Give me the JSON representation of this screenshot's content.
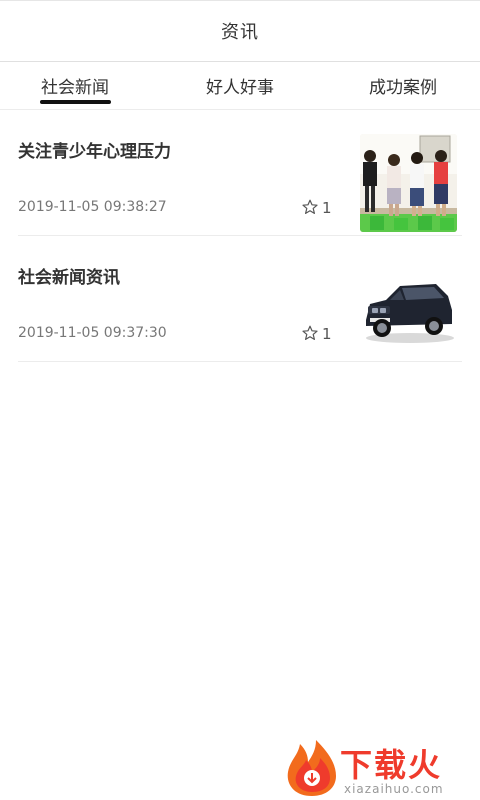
{
  "header": {
    "title": "资讯"
  },
  "tabs": [
    {
      "label": "社会新闻",
      "active": true
    },
    {
      "label": "好人好事",
      "active": false
    },
    {
      "label": "成功案例",
      "active": false
    }
  ],
  "news": [
    {
      "title": "关注青少年心理压力",
      "time": "2019-11-05 09:38:27",
      "favorites": "1",
      "thumb_icon": "children-photo-icon"
    },
    {
      "title": "社会新闻资讯",
      "time": "2019-11-05 09:37:30",
      "favorites": "1",
      "thumb_icon": "suv-car-photo-icon"
    }
  ],
  "watermark": {
    "text": "下载火",
    "sub": "xiazaihuo.com",
    "color": "#ef3b2c"
  },
  "colors": {
    "text": "#333333",
    "muted": "#777777",
    "divider": "#ececec",
    "indicator": "#111111"
  }
}
